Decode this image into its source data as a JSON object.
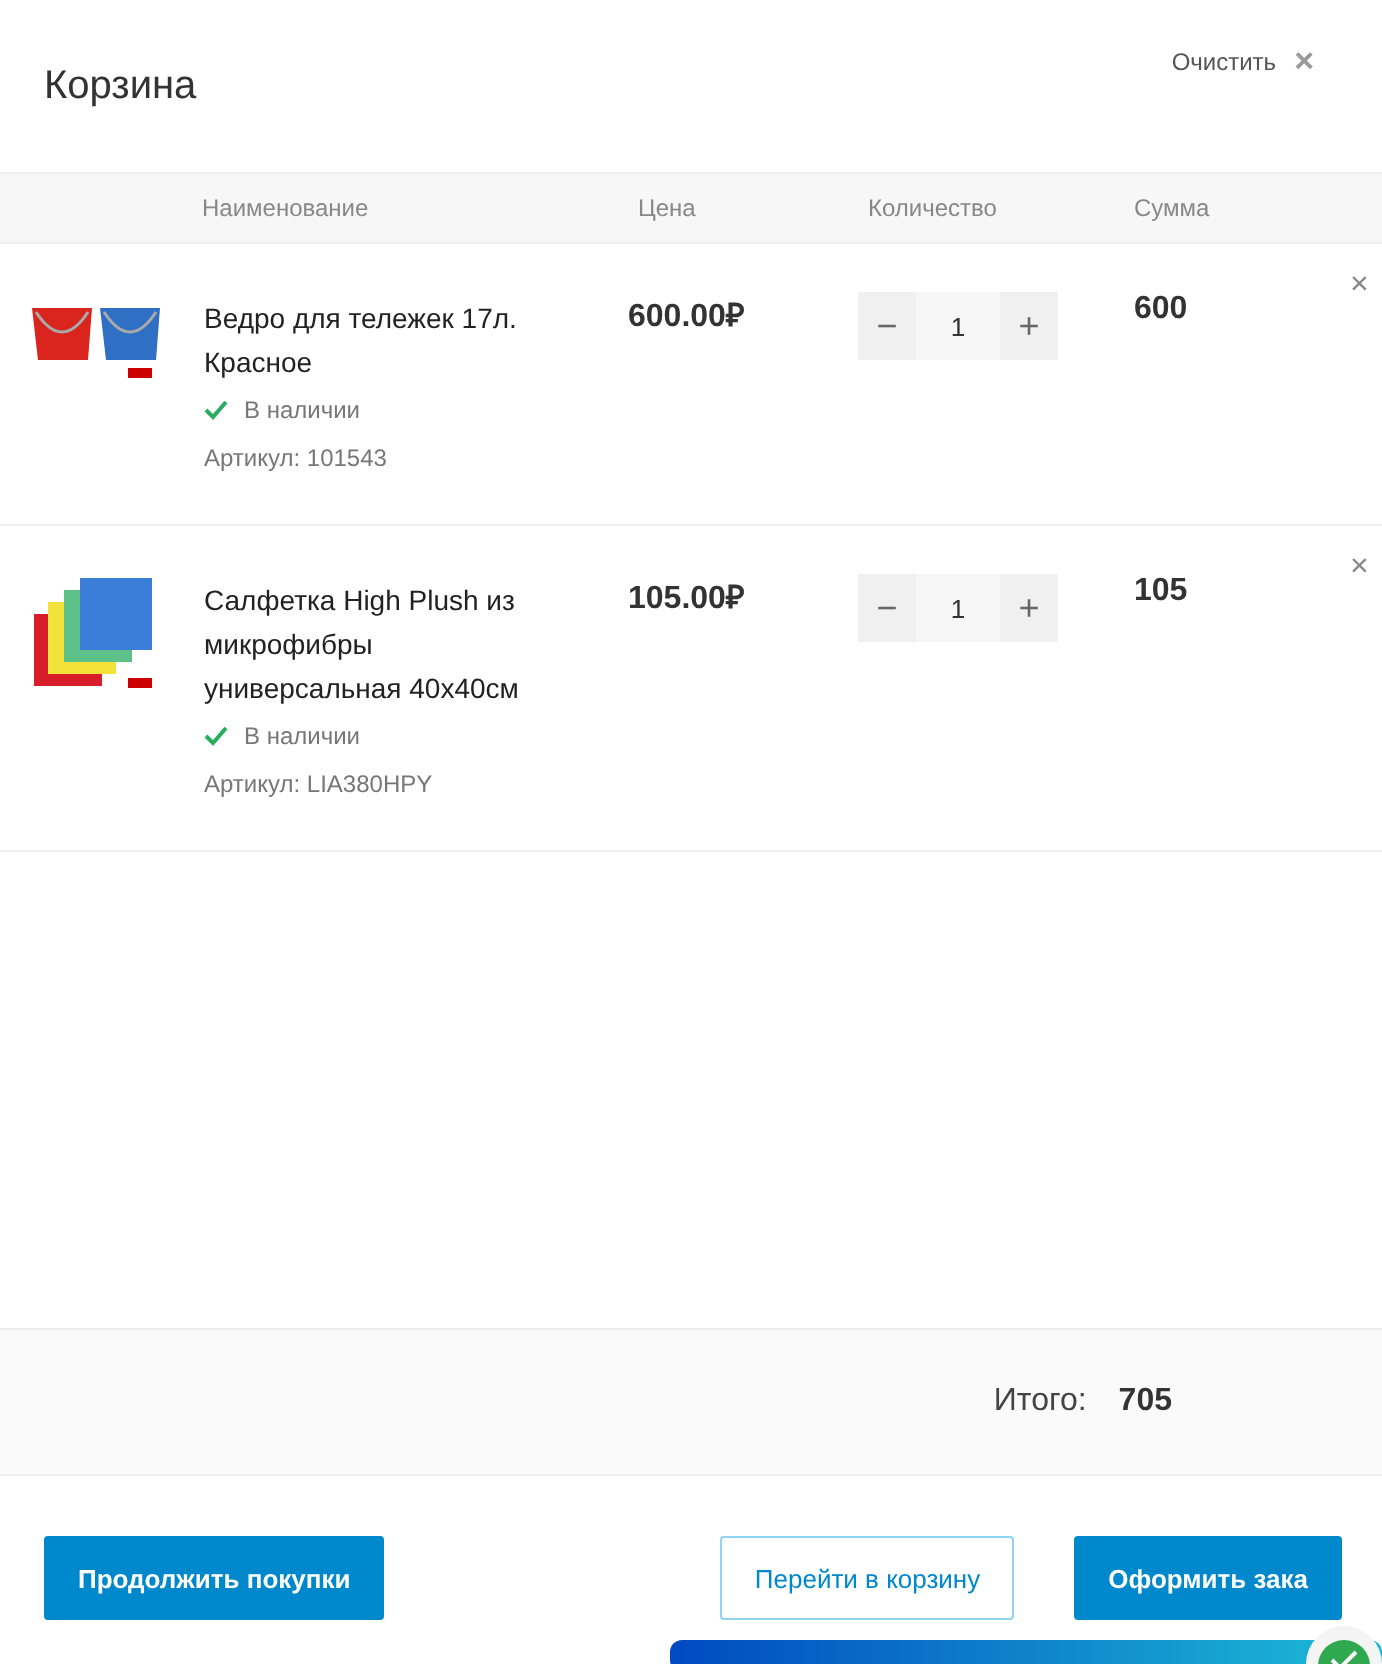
{
  "header": {
    "title": "Корзина",
    "clear_label": "Очистить",
    "clear_icon": "×"
  },
  "columns": [
    "Наименование",
    "Цена",
    "Количество",
    "Сумма"
  ],
  "items": [
    {
      "name": "Ведро для тележек 17л. Красное",
      "availability": "В наличии",
      "in_stock": true,
      "sku": "Артикул: 101543",
      "price": "600.00₽",
      "minus": "−",
      "quantity": "1",
      "plus": "+",
      "sum": "600",
      "remove": "×"
    },
    {
      "name": "Салфетка High Plush из микрофибры универсальная 40x40см",
      "availability": "В наличии",
      "in_stock": true,
      "sku": "Артикул: LIA380HPY",
      "price": "105.00₽",
      "minus": "−",
      "quantity": "1",
      "plus": "+",
      "sum": "105",
      "remove": "×"
    }
  ],
  "total": {
    "label": "Итого:",
    "value": "705"
  },
  "buttons": [
    {
      "label": "Продолжить покупки",
      "kind": "primary"
    },
    {
      "label": "Перейти в корзину",
      "kind": "outline"
    },
    {
      "label": "Оформить зака",
      "kind": "primary"
    }
  ]
}
